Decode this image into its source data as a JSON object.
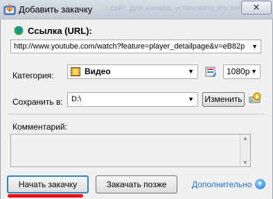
{
  "window": {
    "title": "Добавить закачку",
    "close_label": "✕",
    "background_text": "...сайт. Для начала, установите эту закачку"
  },
  "url": {
    "label": "Ссылка (URL):",
    "value": "http://www.youtube.com/watch?feature=player_detailpage&v=eB82p"
  },
  "category": {
    "label": "Категория:",
    "value": "Видео",
    "resolution": "1080p"
  },
  "save": {
    "label": "Сохранить в:",
    "value": "D:\\",
    "change_button": "Изменить"
  },
  "comment": {
    "label": "Комментарий:",
    "value": ""
  },
  "buttons": {
    "start": "Начать закачку",
    "later": "Закачать позже",
    "more": "Дополнительно"
  },
  "colors": {
    "link": "#1f6fc5",
    "focus_border": "#3c7fb1",
    "highlight_underline": "#e8121a"
  },
  "icons": [
    "app-download-icon",
    "globe-icon",
    "film-icon",
    "category-edit-icon",
    "drive-icon",
    "chevron-down-icon"
  ]
}
